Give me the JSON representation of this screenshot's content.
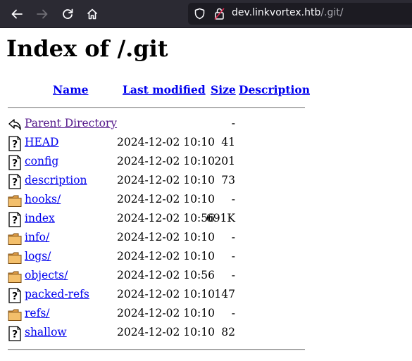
{
  "browser": {
    "url_host": "dev.linkvortex.htb",
    "url_path": "/.git/"
  },
  "page": {
    "title": "Index of /.git"
  },
  "table": {
    "headers": {
      "name": "Name",
      "modified": "Last modified",
      "size": "Size",
      "description": "Description"
    },
    "rows": [
      {
        "name": "Parent Directory",
        "modified": "",
        "size": "-",
        "icon": "back-icon"
      },
      {
        "name": "HEAD",
        "modified": "2024-12-02 10:10",
        "size": "41",
        "icon": "file-unknown-icon"
      },
      {
        "name": "config",
        "modified": "2024-12-02 10:10",
        "size": "201",
        "icon": "file-unknown-icon"
      },
      {
        "name": "description",
        "modified": "2024-12-02 10:10",
        "size": "73",
        "icon": "file-unknown-icon"
      },
      {
        "name": "hooks/",
        "modified": "2024-12-02 10:10",
        "size": "-",
        "icon": "folder-icon"
      },
      {
        "name": "index",
        "modified": "2024-12-02 10:56",
        "size": "691K",
        "icon": "file-unknown-icon"
      },
      {
        "name": "info/",
        "modified": "2024-12-02 10:10",
        "size": "-",
        "icon": "folder-icon"
      },
      {
        "name": "logs/",
        "modified": "2024-12-02 10:10",
        "size": "-",
        "icon": "folder-icon"
      },
      {
        "name": "objects/",
        "modified": "2024-12-02 10:56",
        "size": "-",
        "icon": "folder-icon"
      },
      {
        "name": "packed-refs",
        "modified": "2024-12-02 10:10",
        "size": "147",
        "icon": "file-unknown-icon"
      },
      {
        "name": "refs/",
        "modified": "2024-12-02 10:10",
        "size": "-",
        "icon": "folder-icon"
      },
      {
        "name": "shallow",
        "modified": "2024-12-02 10:10",
        "size": "82",
        "icon": "file-unknown-icon"
      }
    ]
  },
  "colors": {
    "toolbar_bg": "#2b2a33",
    "link": "#0000ee",
    "visited_link": "#551a8b"
  }
}
